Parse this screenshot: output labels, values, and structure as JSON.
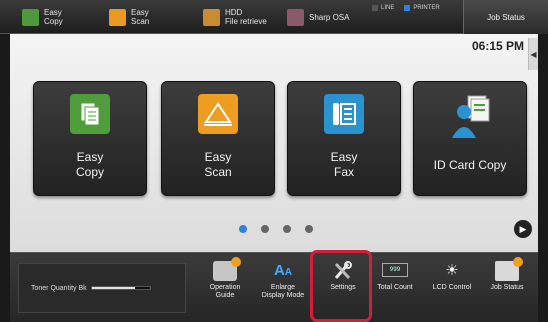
{
  "topbar": {
    "shortcuts": [
      {
        "label": "Easy\nCopy",
        "icon": "copy-icon"
      },
      {
        "label": "Easy\nScan",
        "icon": "scan-icon"
      },
      {
        "label": "HDD\nFile retrieve",
        "icon": "folder-icon"
      },
      {
        "label": "Sharp OSA",
        "icon": "osa-icon"
      }
    ],
    "status": {
      "line": "LINE",
      "printer": "PRINTER"
    },
    "job_status": "Job Status"
  },
  "main": {
    "clock": "06:15 PM",
    "tiles": [
      {
        "label": "Easy\nCopy",
        "icon": "copy-icon"
      },
      {
        "label": "Easy\nScan",
        "icon": "scan-icon"
      },
      {
        "label": "Easy\nFax",
        "icon": "fax-icon"
      },
      {
        "label": "ID Card Copy",
        "icon": "id-card-icon"
      }
    ],
    "pager": {
      "count": 4,
      "active": 1
    }
  },
  "bottombar": {
    "toner_label": "Toner Quantity  Bk",
    "toner_level": 0.75,
    "items": [
      {
        "label": "Operation\nGuide",
        "icon": "guide-icon"
      },
      {
        "label": "Enlarge\nDisplay Mode",
        "icon": "enlarge-icon"
      },
      {
        "label": "Settings",
        "icon": "settings-icon"
      },
      {
        "label": "Total Count",
        "icon": "counter-icon",
        "display": "999"
      },
      {
        "label": "LCD Control",
        "icon": "brightness-icon"
      },
      {
        "label": "Job Status",
        "icon": "printer-icon"
      }
    ]
  },
  "colors": {
    "highlight": "#d3203a",
    "accent": "#2b82e0"
  }
}
